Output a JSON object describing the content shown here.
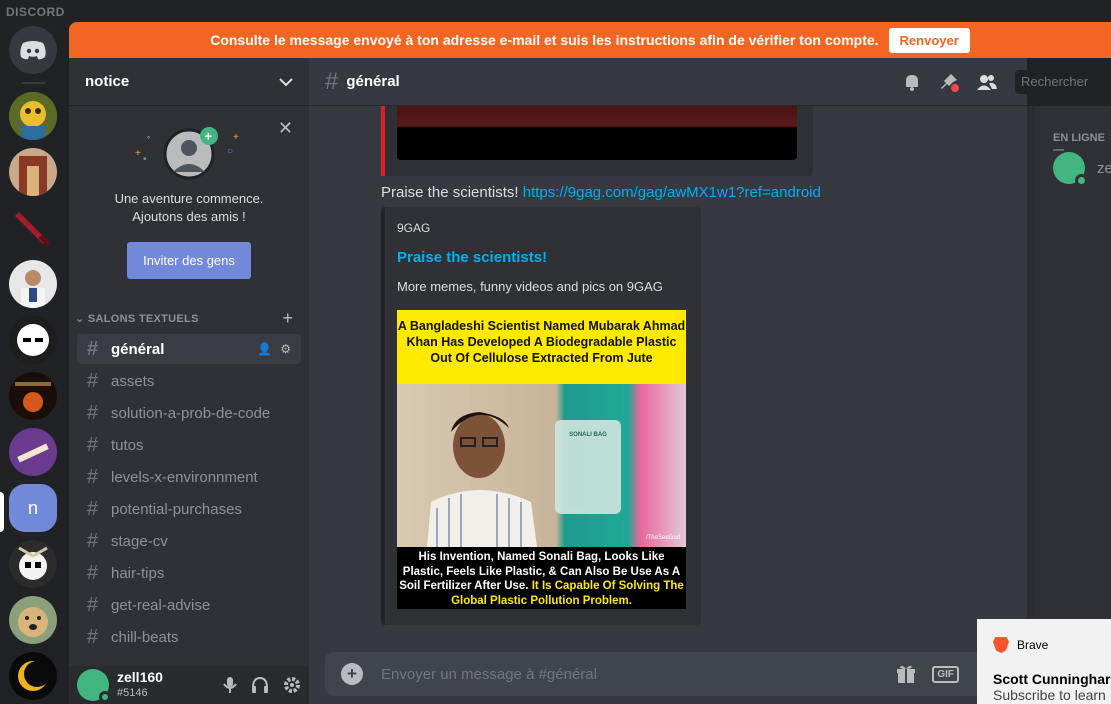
{
  "app": {
    "wordmark": "DISCORD"
  },
  "banner": {
    "message": "Consulte le message envoyé à ton adresse e-mail et suis les instructions afin de vérifier ton compte.",
    "button": "Renvoyer"
  },
  "servers": [
    {
      "name": "server-1",
      "color": "#c9a22c"
    },
    {
      "name": "server-2",
      "color": "#7a4a2a"
    },
    {
      "name": "server-3",
      "color": "#8b1a1a"
    },
    {
      "name": "server-4",
      "color": "#d9d9d9"
    },
    {
      "name": "server-5",
      "color": "#2b2b2b"
    },
    {
      "name": "server-6",
      "color": "#3a2410"
    },
    {
      "name": "server-7",
      "color": "#6a3b8f"
    },
    {
      "name": "server-8",
      "letter": "n",
      "color": "#7289da"
    },
    {
      "name": "server-9",
      "color": "#e6d9c2"
    },
    {
      "name": "server-10",
      "color": "#b5a37a"
    },
    {
      "name": "server-11",
      "color": "#111111"
    }
  ],
  "sidebar": {
    "server_name": "notice",
    "invite": {
      "line1": "Une aventure commence.",
      "line2": "Ajoutons des amis !",
      "button": "Inviter des gens"
    },
    "category": "SALONS TEXTUELS",
    "channels": [
      {
        "name": "général",
        "active": true
      },
      {
        "name": "assets"
      },
      {
        "name": "solution-a-prob-de-code"
      },
      {
        "name": "tutos"
      },
      {
        "name": "levels-x-environnment"
      },
      {
        "name": "potential-purchases"
      },
      {
        "name": "stage-cv"
      },
      {
        "name": "hair-tips"
      },
      {
        "name": "get-real-advise"
      },
      {
        "name": "chill-beats"
      }
    ],
    "user": {
      "name": "zell160",
      "tag": "#5146"
    }
  },
  "chat": {
    "channel": "général",
    "search_placeholder": "Rechercher",
    "message": {
      "text": "Praise the scientists!",
      "link": "https://9gag.com/gag/awMX1w1?ref=android"
    },
    "embed": {
      "provider": "9GAG",
      "title": "Praise the scientists!",
      "description": "More memes, funny videos and pics on 9GAG",
      "image_top": "A Bangladeshi Scientist Named Mubarak Ahmad Khan Has Developed A Biodegradable Plastic Out Of Cellulose Extracted From Jute",
      "image_bottom": "His Invention, Named Sonali Bag, Looks Like Plastic, Feels Like Plastic, & Can Also Be Use As A Soil Fertilizer After Use.",
      "image_bottom_highlight": "It Is Capable Of Solving The Global Plastic Pollution Problem.",
      "bag_label": "SONALI BAG",
      "watermark": "/TheSeeGod"
    },
    "composer_placeholder": "Envoyer un message à #général",
    "gif_label": "GIF"
  },
  "members": {
    "heading": "EN LIGNE—",
    "first_member": "ze"
  },
  "toast": {
    "app": "Brave",
    "title": "Scott Cunninghar",
    "body": "Subscribe to learn"
  },
  "colors": {
    "brand": "#7289da",
    "banner": "#f26522",
    "online": "#43b581",
    "link": "#00b0f4"
  }
}
